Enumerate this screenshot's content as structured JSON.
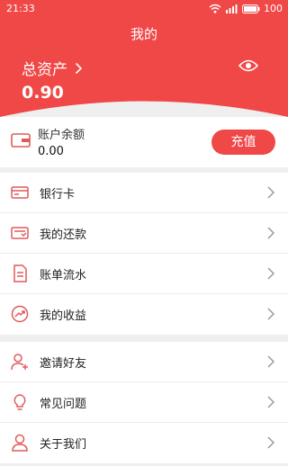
{
  "status": {
    "time": "21:33",
    "battery": "100"
  },
  "header": {
    "title": "我的",
    "assets_label": "总资产",
    "assets_value": "0.90"
  },
  "balance": {
    "label": "账户余额",
    "value": "0.00",
    "recharge_label": "充值"
  },
  "group1": [
    {
      "label": "银行卡",
      "icon": "bank-card-icon"
    },
    {
      "label": "我的还款",
      "icon": "repayment-icon"
    },
    {
      "label": "账单流水",
      "icon": "bill-flow-icon"
    },
    {
      "label": "我的收益",
      "icon": "earnings-icon"
    }
  ],
  "group2": [
    {
      "label": "邀请好友",
      "icon": "invite-friend-icon"
    },
    {
      "label": "常见问题",
      "icon": "faq-icon"
    },
    {
      "label": "关于我们",
      "icon": "about-us-icon"
    }
  ],
  "colors": {
    "accent": "#f04747",
    "icon": "#e05a5a",
    "chevron": "#9a9a9a"
  }
}
